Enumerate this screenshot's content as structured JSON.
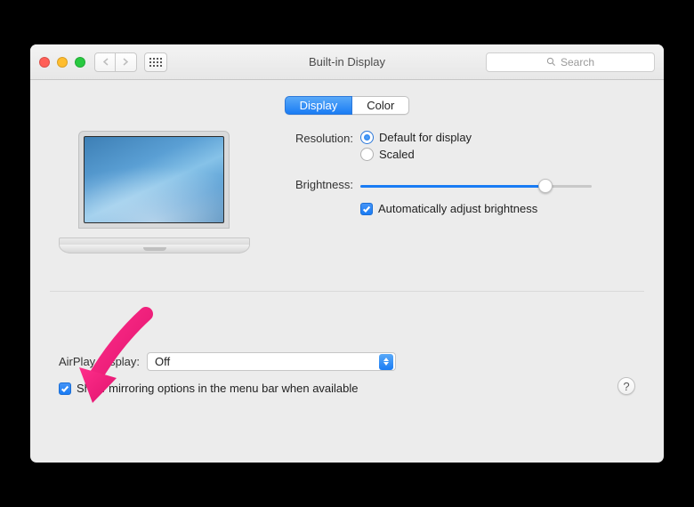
{
  "window": {
    "title": "Built-in Display"
  },
  "toolbar": {
    "search_placeholder": "Search"
  },
  "tabs": {
    "display": "Display",
    "color": "Color",
    "active": "display"
  },
  "resolution": {
    "label": "Resolution:",
    "default_opt": "Default for display",
    "scaled_opt": "Scaled",
    "selected": "default"
  },
  "brightness": {
    "label": "Brightness:",
    "value_pct": 80,
    "auto_label": "Automatically adjust brightness",
    "auto_checked": true
  },
  "airplay": {
    "label": "AirPlay Display:",
    "value": "Off"
  },
  "mirroring": {
    "label": "Show mirroring options in the menu bar when available",
    "checked": true
  },
  "help": {
    "glyph": "?"
  }
}
